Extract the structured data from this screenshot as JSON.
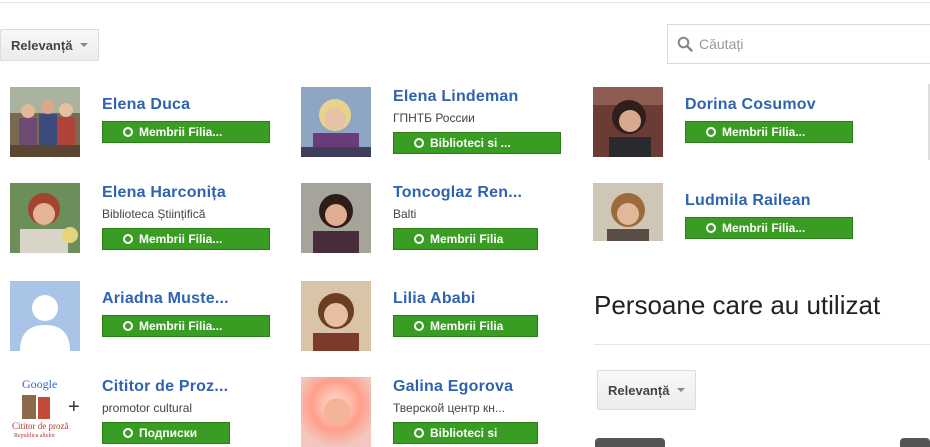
{
  "sort": {
    "label": "Relevanță"
  },
  "search": {
    "placeholder": "Căutați"
  },
  "people": [
    {
      "name": "Elena Duca",
      "subtitle": "",
      "circle": "Membrii Filia..."
    },
    {
      "name": "Elena Lindeman",
      "subtitle": "ГПНТБ России",
      "circle": "Biblioteci si ..."
    },
    {
      "name": "Dorina Cosumov",
      "subtitle": "",
      "circle": "Membrii Filia..."
    },
    {
      "name": "Elena Harconița",
      "subtitle": "Biblioteca Științifică",
      "circle": "Membrii Filia..."
    },
    {
      "name": "Toncoglaz Ren...",
      "subtitle": "Balti",
      "circle": "Membrii Filia"
    },
    {
      "name": "Ludmila Railean",
      "subtitle": "",
      "circle": "Membrii Filia..."
    },
    {
      "name": "Ariadna Muste...",
      "subtitle": "",
      "circle": "Membrii Filia..."
    },
    {
      "name": "Lilia Ababi",
      "subtitle": "",
      "circle": "Membrii Filia"
    },
    {
      "name": "Cititor de Proz...",
      "subtitle": "promotor cultural",
      "circle": "Подписки"
    },
    {
      "name": "Galina Egorova",
      "subtitle": "Тверской центр кн...",
      "circle": "Biblioteci si"
    }
  ],
  "logo": {
    "top": "Google",
    "bottom": "Cititor de proză",
    "small": "Republica altelor"
  },
  "section": {
    "title": "Persoane care au utilizat",
    "sort_label": "Relevanță"
  }
}
